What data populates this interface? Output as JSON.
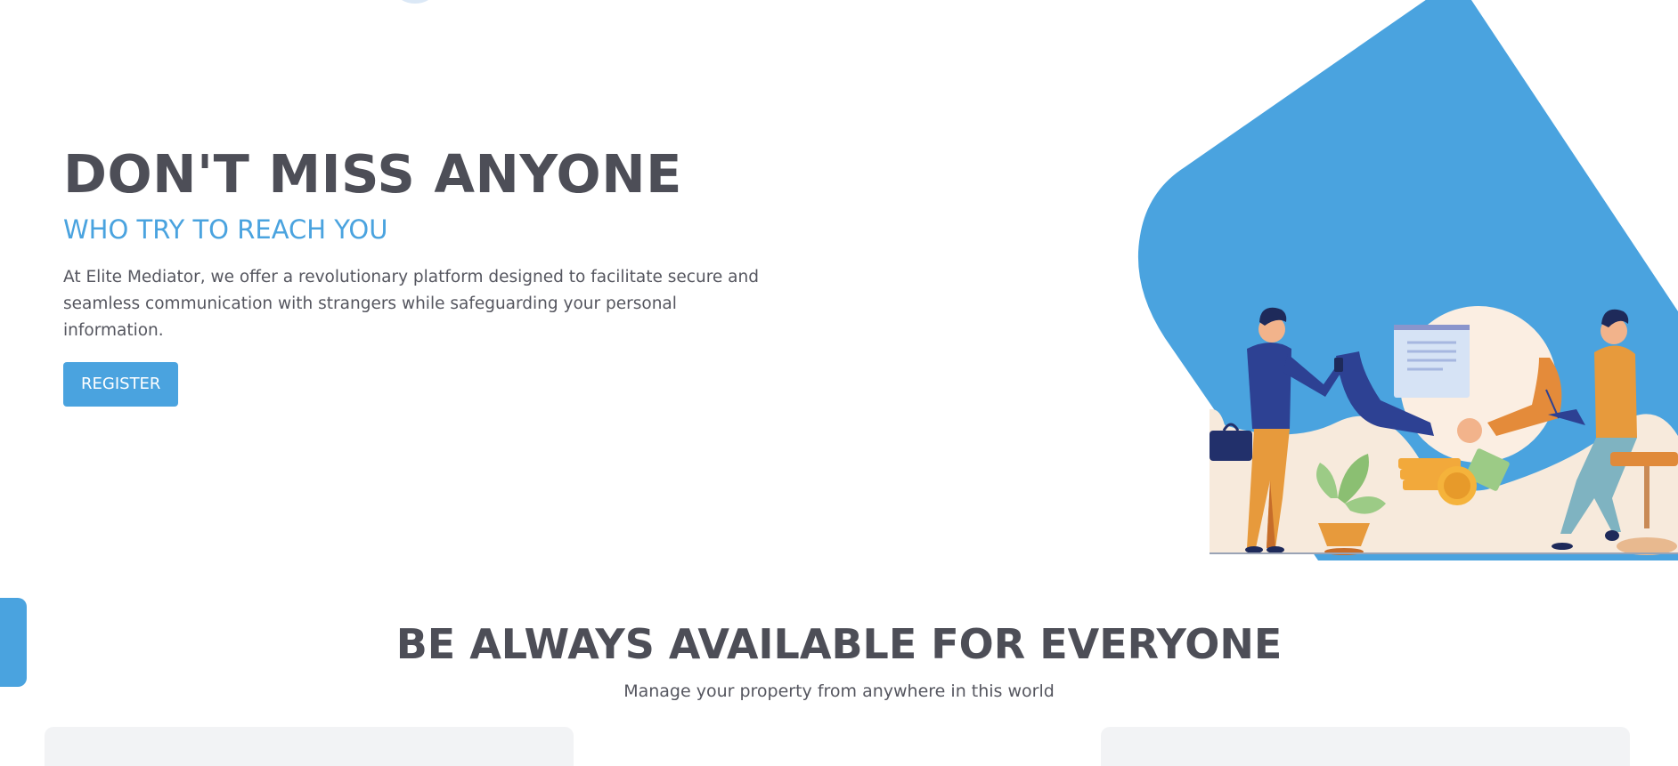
{
  "hero": {
    "title": "DON'T MISS ANYONE",
    "subtitle": "WHO TRY TO REACH YOU",
    "description": "At Elite Mediator, we offer a revolutionary platform designed to facilitate secure and seamless communication with strangers while safeguarding your personal information.",
    "register_label": "REGISTER"
  },
  "illustration": {
    "icon": "handshake-deal-illustration",
    "accent_color": "#4aa3df"
  },
  "features": {
    "title": "BE ALWAYS AVAILABLE FOR EVERYONE",
    "subtitle": "Manage your property from anywhere in this world"
  },
  "colors": {
    "accent": "#4aa3df",
    "heading": "#4d4e57",
    "body_text": "#55565f",
    "card_bg": "#f2f3f5"
  }
}
